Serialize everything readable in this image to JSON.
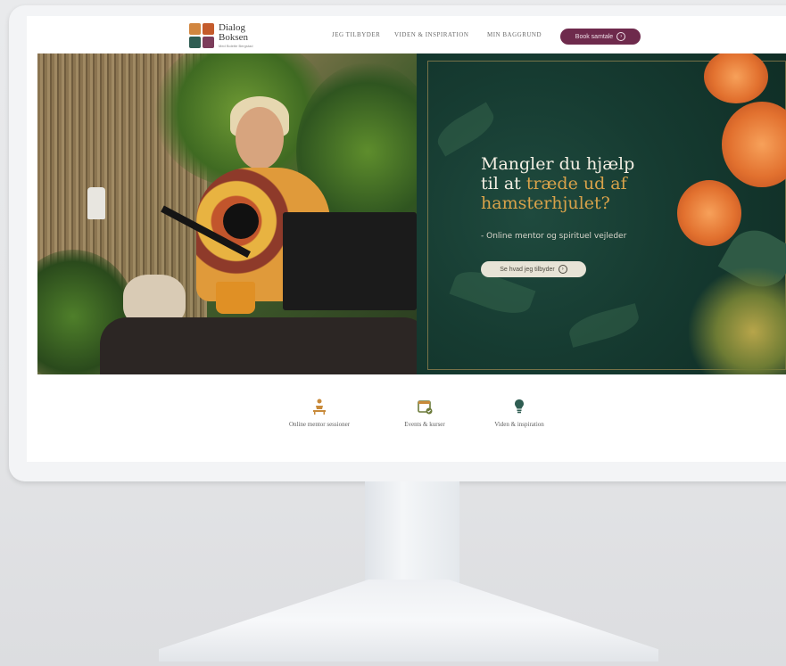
{
  "brand": {
    "name_line1": "Dialog",
    "name_line2": "Boksen",
    "tagline": "Med Bolette Bergstad"
  },
  "nav": {
    "items": [
      "JEG TILBYDER",
      "VIDEN & INSPIRATION",
      "MIN BAGGRUND"
    ],
    "cta_label": "Book samtale"
  },
  "hero": {
    "headline_line1": "Mangler du hjælp",
    "headline_line2_plain": "til at ",
    "headline_line2_gold": "træde ud af",
    "headline_line3_gold": "hamsterhjulet?",
    "subline": "- Online mentor og spirituel vejleder",
    "button_label": "Se hvad jeg tilbyder",
    "colors": {
      "panel": "#163b31",
      "gold": "#d8a24a",
      "cta": "#6e2a4c"
    }
  },
  "features": [
    {
      "icon": "person-table-icon",
      "label": "Online mentor sessioner"
    },
    {
      "icon": "calendar-icon",
      "label": "Events & kurser"
    },
    {
      "icon": "lightbulb-icon",
      "label": "Viden & inspiration"
    }
  ]
}
